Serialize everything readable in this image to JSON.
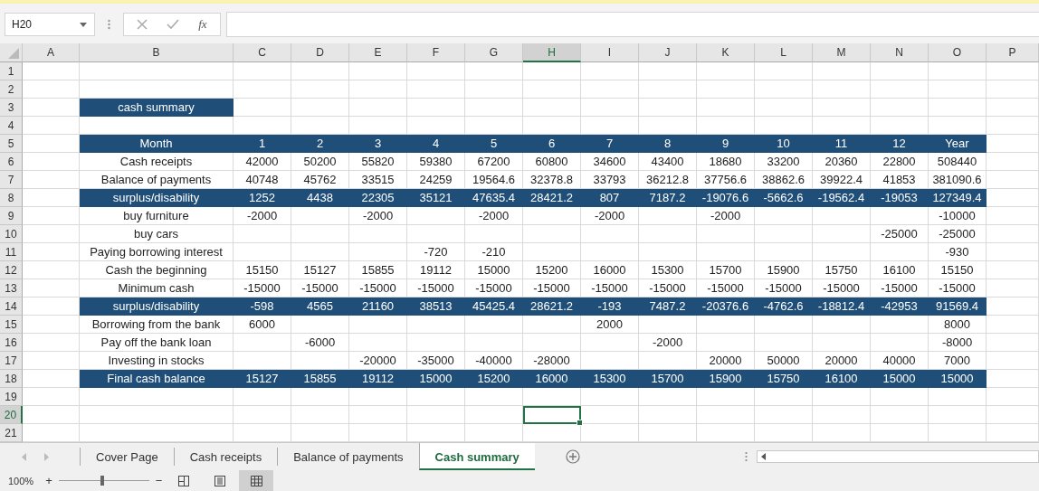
{
  "name_box": {
    "value": "H20"
  },
  "formula_bar": {
    "function_label": "fx"
  },
  "columns": [
    {
      "label": "A",
      "selected": false
    },
    {
      "label": "B",
      "selected": false
    },
    {
      "label": "C",
      "selected": false
    },
    {
      "label": "D",
      "selected": false
    },
    {
      "label": "E",
      "selected": false
    },
    {
      "label": "F",
      "selected": false
    },
    {
      "label": "G",
      "selected": false
    },
    {
      "label": "H",
      "selected": true
    },
    {
      "label": "I",
      "selected": false
    },
    {
      "label": "J",
      "selected": false
    },
    {
      "label": "K",
      "selected": false
    },
    {
      "label": "L",
      "selected": false
    },
    {
      "label": "M",
      "selected": false
    },
    {
      "label": "N",
      "selected": false
    },
    {
      "label": "O",
      "selected": false
    },
    {
      "label": "P",
      "selected": false
    }
  ],
  "rows": [
    {
      "number": "1",
      "selected": false,
      "kind": "empty"
    },
    {
      "number": "2",
      "selected": false,
      "kind": "empty"
    },
    {
      "number": "3",
      "selected": false,
      "kind": "title",
      "text": "cash summary"
    },
    {
      "number": "4",
      "selected": false,
      "kind": "empty"
    },
    {
      "number": "5",
      "selected": false,
      "kind": "table",
      "band": true,
      "cells": [
        "Month",
        "1",
        "2",
        "3",
        "4",
        "5",
        "6",
        "7",
        "8",
        "9",
        "10",
        "11",
        "12",
        "Year"
      ]
    },
    {
      "number": "6",
      "selected": false,
      "kind": "table",
      "band": false,
      "cells": [
        "Cash receipts",
        "42000",
        "50200",
        "55820",
        "59380",
        "67200",
        "60800",
        "34600",
        "43400",
        "18680",
        "33200",
        "20360",
        "22800",
        "508440"
      ]
    },
    {
      "number": "7",
      "selected": false,
      "kind": "table",
      "band": false,
      "cells": [
        "Balance of payments",
        "40748",
        "45762",
        "33515",
        "24259",
        "19564.6",
        "32378.8",
        "33793",
        "36212.8",
        "37756.6",
        "38862.6",
        "39922.4",
        "41853",
        "381090.6"
      ]
    },
    {
      "number": "8",
      "selected": false,
      "kind": "table",
      "band": true,
      "cells": [
        "surplus/disability",
        "1252",
        "4438",
        "22305",
        "35121",
        "47635.4",
        "28421.2",
        "807",
        "7187.2",
        "-19076.6",
        "-5662.6",
        "-19562.4",
        "-19053",
        "127349.4"
      ]
    },
    {
      "number": "9",
      "selected": false,
      "kind": "table",
      "band": false,
      "cells": [
        "buy furniture",
        "-2000",
        null,
        "-2000",
        null,
        "-2000",
        null,
        "-2000",
        null,
        "-2000",
        null,
        null,
        null,
        "-10000"
      ]
    },
    {
      "number": "10",
      "selected": false,
      "kind": "table",
      "band": false,
      "cells": [
        "buy cars",
        null,
        null,
        null,
        null,
        null,
        null,
        null,
        null,
        null,
        null,
        null,
        "-25000",
        "-25000"
      ]
    },
    {
      "number": "11",
      "selected": false,
      "kind": "table",
      "band": false,
      "cells": [
        "Paying borrowing interest",
        null,
        null,
        null,
        "-720",
        "-210",
        null,
        null,
        null,
        null,
        null,
        null,
        null,
        "-930"
      ]
    },
    {
      "number": "12",
      "selected": false,
      "kind": "table",
      "band": false,
      "cells": [
        "Cash the beginning",
        "15150",
        "15127",
        "15855",
        "19112",
        "15000",
        "15200",
        "16000",
        "15300",
        "15700",
        "15900",
        "15750",
        "16100",
        "15150"
      ]
    },
    {
      "number": "13",
      "selected": false,
      "kind": "table",
      "band": false,
      "cells": [
        "Minimum cash",
        "-15000",
        "-15000",
        "-15000",
        "-15000",
        "-15000",
        "-15000",
        "-15000",
        "-15000",
        "-15000",
        "-15000",
        "-15000",
        "-15000",
        "-15000"
      ]
    },
    {
      "number": "14",
      "selected": false,
      "kind": "table",
      "band": true,
      "cells": [
        "surplus/disability",
        "-598",
        "4565",
        "21160",
        "38513",
        "45425.4",
        "28621.2",
        "-193",
        "7487.2",
        "-20376.6",
        "-4762.6",
        "-18812.4",
        "-42953",
        "91569.4"
      ]
    },
    {
      "number": "15",
      "selected": false,
      "kind": "table",
      "band": false,
      "cells": [
        "Borrowing from the bank",
        "6000",
        null,
        null,
        null,
        null,
        null,
        "2000",
        null,
        null,
        null,
        null,
        null,
        "8000"
      ]
    },
    {
      "number": "16",
      "selected": false,
      "kind": "table",
      "band": false,
      "cells": [
        "Pay off the bank loan",
        null,
        "-6000",
        null,
        null,
        null,
        null,
        null,
        "-2000",
        null,
        null,
        null,
        null,
        "-8000"
      ]
    },
    {
      "number": "17",
      "selected": false,
      "kind": "table",
      "band": false,
      "cells": [
        "Investing in stocks",
        null,
        null,
        "-20000",
        "-35000",
        "-40000",
        "-28000",
        null,
        null,
        "20000",
        "50000",
        "20000",
        "40000",
        "7000"
      ]
    },
    {
      "number": "18",
      "selected": false,
      "kind": "table",
      "band": true,
      "cells": [
        "Final cash balance",
        "15127",
        "15855",
        "19112",
        "15000",
        "15200",
        "16000",
        "15300",
        "15700",
        "15900",
        "15750",
        "16100",
        "15000",
        "15000"
      ]
    },
    {
      "number": "19",
      "selected": false,
      "kind": "empty"
    },
    {
      "number": "20",
      "selected": true,
      "kind": "empty"
    },
    {
      "number": "21",
      "selected": false,
      "kind": "empty"
    }
  ],
  "sheet_tabs": [
    {
      "label": "Cover Page",
      "selected": false
    },
    {
      "label": "Cash receipts",
      "selected": false
    },
    {
      "label": "Balance of payments",
      "selected": false
    },
    {
      "label": "Cash summary",
      "selected": true
    }
  ],
  "status_bar": {
    "zoom": "100%",
    "zoom_in": "+",
    "zoom_out": "−",
    "level": 0.48,
    "views": [
      {
        "kind": "layout",
        "selected": false
      },
      {
        "kind": "page",
        "selected": false
      },
      {
        "kind": "normal",
        "selected": true
      }
    ]
  }
}
